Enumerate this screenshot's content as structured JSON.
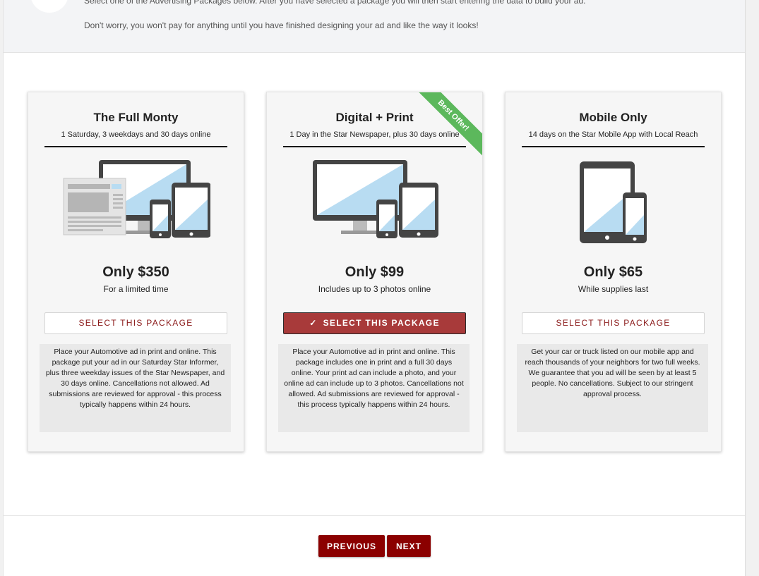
{
  "intro": {
    "line1": "Select one of the Advertising Packages below. After you have selected a package you will then start entering the data to build your ad.",
    "line2": "Don't worry, you won't pay for anything until you have finished designing your ad and like the way it looks!"
  },
  "packages": [
    {
      "title": "The Full Monty",
      "subtitle": "1 Saturday, 3 weekdays and 30 days online",
      "image_icon": "newspaper-monitor-phone-tablet-icon",
      "price": "Only $350",
      "note": "For a limited time",
      "button_label": "SELECT THIS PACKAGE",
      "selected": false,
      "description": "Place your Automotive ad in print and online. This package put your ad in our Saturday Star Informer, plus three weekday issues of the Star Newspaper, and 30 days online. Cancellations not allowed. Ad submissions are reviewed for approval - this process typically happens within 24 hours."
    },
    {
      "title": "Digital + Print",
      "subtitle": "1 Day in the Star Newspaper, plus 30 days online",
      "image_icon": "monitor-phone-tablet-icon",
      "price": "Only $99",
      "note": "Includes up to 3 photos online",
      "button_label": "SELECT THIS PACKAGE",
      "selected": true,
      "ribbon": "Best Offer!",
      "description": "Place your Automotive ad in print and online. This package includes one in print and a full 30 days online. Your print ad can include a photo, and your online ad can include up to 3 photos. Cancellations not allowed. Ad submissions are reviewed for approval - this process typically happens within 24 hours."
    },
    {
      "title": "Mobile Only",
      "subtitle": "14 days on the Star Mobile App with Local Reach",
      "image_icon": "tablet-phone-icon",
      "price": "Only $65",
      "note": "While supplies last",
      "button_label": "SELECT THIS PACKAGE",
      "selected": false,
      "description": "Get your car or truck listed on our mobile app and reach thousands of your neighbors for two full weeks. We guarantee that you ad will be seen by at least 5 people. No cancellations. Subject to our stringent approval process."
    }
  ],
  "nav": {
    "previous_label": "PREVIOUS",
    "next_label": "NEXT"
  },
  "colors": {
    "accent": "#8b0000",
    "selected_button": "#a83a3a",
    "ribbon": "#5cb85c",
    "screen_blue": "#b8dcf2"
  }
}
